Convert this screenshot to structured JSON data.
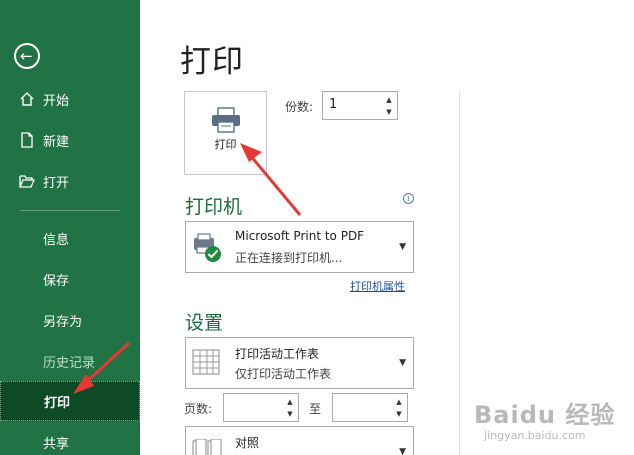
{
  "sidebar": {
    "items": [
      {
        "label": "开始",
        "icon": "home-icon"
      },
      {
        "label": "新建",
        "icon": "new-document-icon"
      },
      {
        "label": "打开",
        "icon": "open-folder-icon"
      },
      {
        "label": "信息"
      },
      {
        "label": "保存"
      },
      {
        "label": "另存为"
      },
      {
        "label": "历史记录"
      },
      {
        "label": "打印"
      },
      {
        "label": "共享"
      }
    ],
    "active": "打印",
    "accent": "#217346",
    "active_bg": "#0f4a27"
  },
  "main": {
    "title": "打印",
    "print_button": {
      "label": "打印",
      "icon": "printer-icon"
    },
    "copies": {
      "label": "份数:",
      "value": "1"
    },
    "printer": {
      "heading": "打印机",
      "name": "Microsoft Print to PDF",
      "status": "正在连接到打印机...",
      "properties_link": "打印机属性"
    },
    "settings": {
      "heading": "设置",
      "print_what": {
        "title": "打印活动工作表",
        "subtitle": "仅打印活动工作表"
      },
      "pages": {
        "label": "页数:",
        "to_label": "至",
        "from_value": "",
        "to_value": ""
      },
      "collate": {
        "title": "对照"
      }
    }
  },
  "watermark": {
    "text": "Baidu 经验",
    "url": "jingyan.baidu.com"
  },
  "colors": {
    "heading": "#1e6b3f",
    "annotation": "#e53935",
    "link": "#1f4e9c"
  }
}
